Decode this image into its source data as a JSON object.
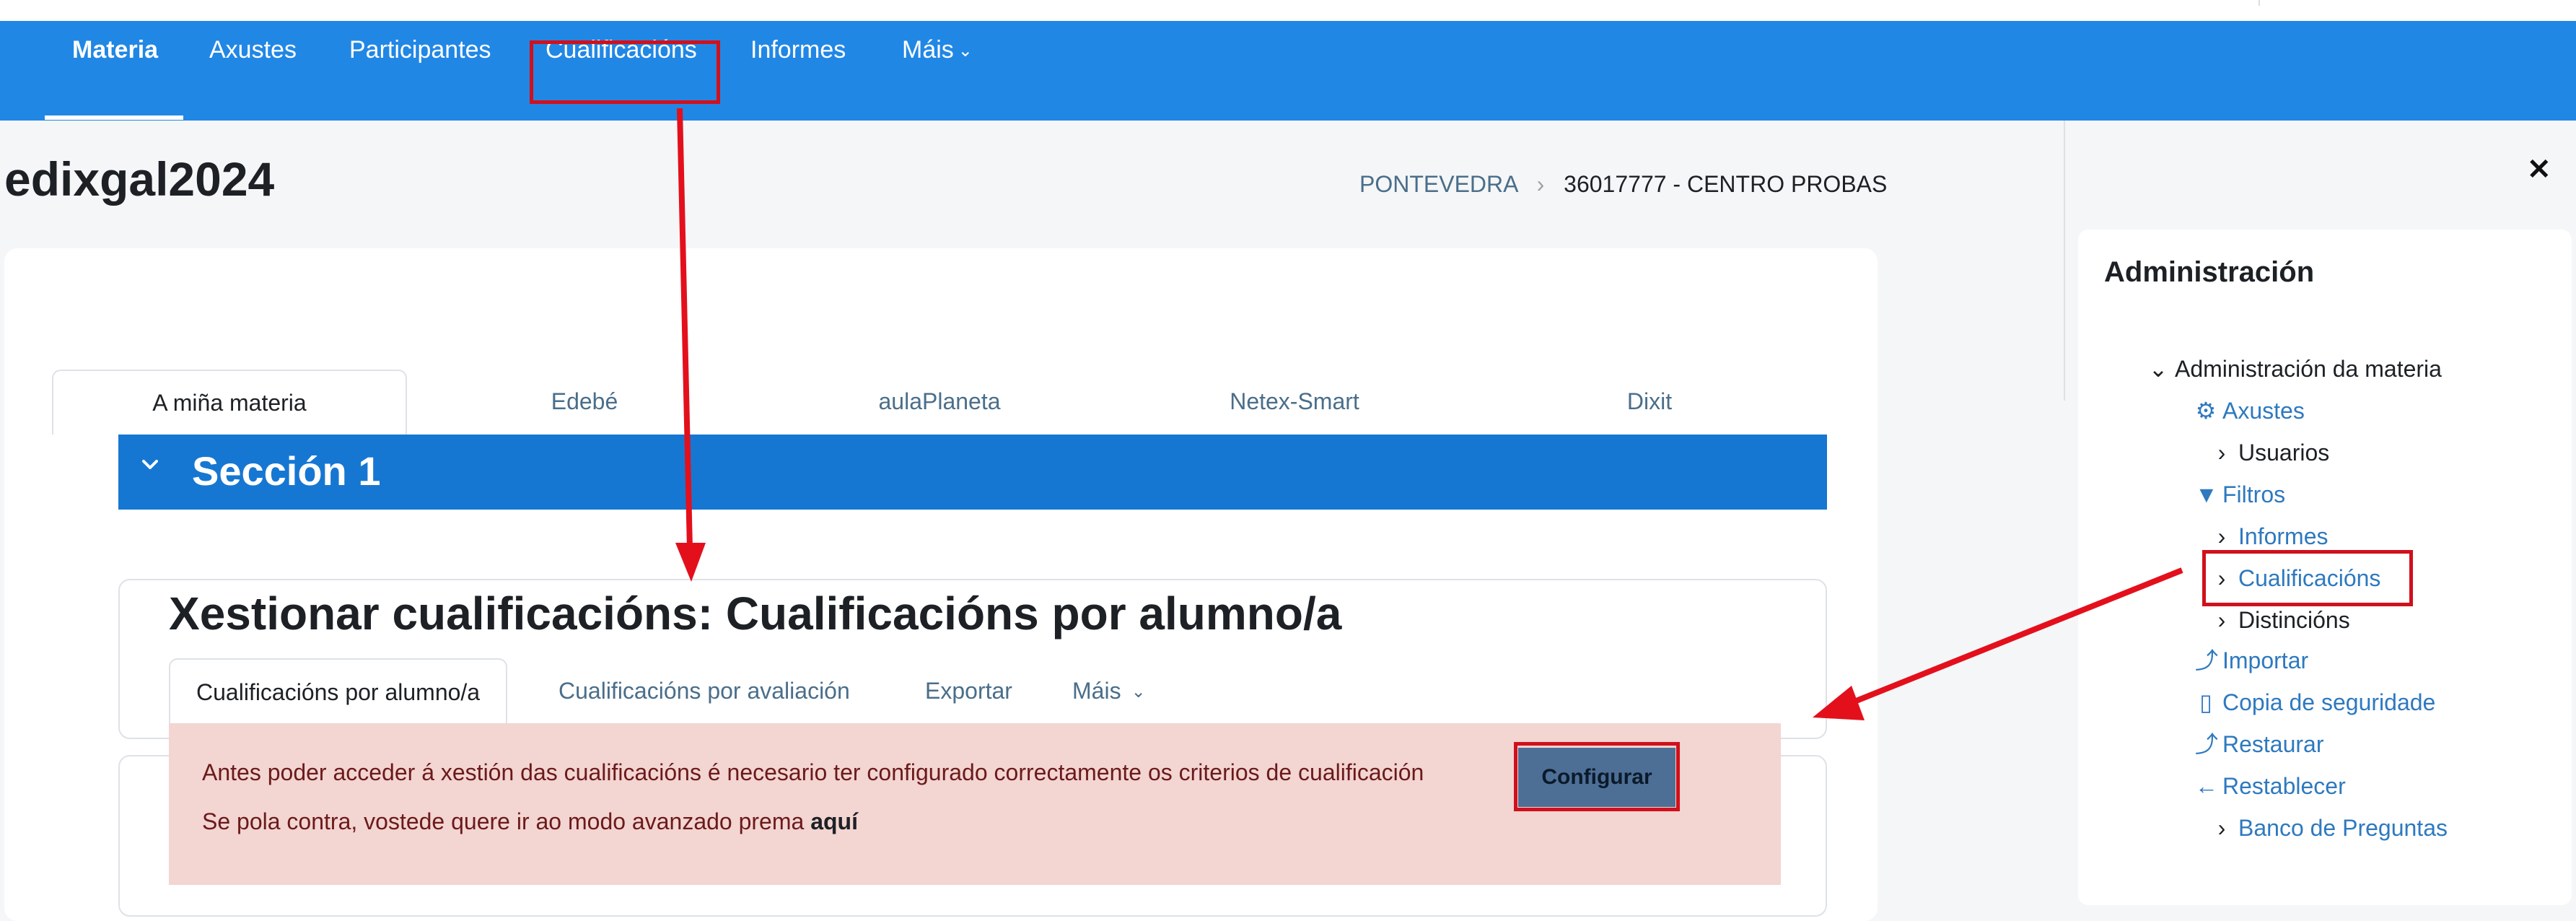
{
  "navbar": {
    "items": [
      {
        "label": "Materia",
        "active": true
      },
      {
        "label": "Axustes"
      },
      {
        "label": "Participantes"
      },
      {
        "label": "Cualificacións",
        "highlighted": true
      },
      {
        "label": "Informes"
      },
      {
        "label": "Máis"
      }
    ]
  },
  "page": {
    "title": "edixgal2024",
    "breadcrumb": [
      "PONTEVEDRA",
      "36017777 - CENTRO PROBAS"
    ]
  },
  "course_tabs": [
    "A miña materia",
    "Edebé",
    "aulaPlaneta",
    "Netex-Smart",
    "Dixit"
  ],
  "section": {
    "title": "Sección 1"
  },
  "grades": {
    "title": "Xestionar cualificacións: Cualificacións por alumno/a",
    "tabs": [
      "Cualificacións por alumno/a",
      "Cualificacións por avaliación",
      "Exportar",
      "Máis"
    ]
  },
  "alert": {
    "line1": "Antes poder acceder á xestión das cualificacións é necesario ter configurado correctamente os criterios de cualificación",
    "line2_prefix": "Se pola contra, vostede quere ir ao modo avanzado prema",
    "line2_link": "aquí",
    "configure_button": "Configurar"
  },
  "drawer": {
    "close": "✕",
    "title": "Administración",
    "tree": [
      {
        "label": "Administración da materia",
        "icon": "chevron-down-icon"
      },
      {
        "label": "Axustes",
        "icon": "gear-icon"
      },
      {
        "label": "Usuarios",
        "icon": "chevron-right-icon"
      },
      {
        "label": "Filtros",
        "icon": "filter-icon"
      },
      {
        "label": "Informes",
        "icon": "chevron-right-icon"
      },
      {
        "label": "Cualificacións",
        "icon": "chevron-right-icon",
        "highlighted": true
      },
      {
        "label": "Distincións",
        "icon": "chevron-right-icon"
      },
      {
        "label": "Importar",
        "icon": "import-icon"
      },
      {
        "label": "Copia de seguridade",
        "icon": "file-icon"
      },
      {
        "label": "Restaurar",
        "icon": "restore-icon"
      },
      {
        "label": "Restablecer",
        "icon": "arrow-left-icon"
      },
      {
        "label": "Banco de Preguntas",
        "icon": "chevron-right-icon"
      }
    ]
  },
  "colors": {
    "navbar": "#2187e5",
    "section_bar": "#1677d2",
    "alert_bg": "#f3d5d2",
    "alert_text": "#6b1a1a",
    "annotation_red": "#d0101c",
    "link": "#2e79bf",
    "configure_button": "#4d6f96"
  }
}
